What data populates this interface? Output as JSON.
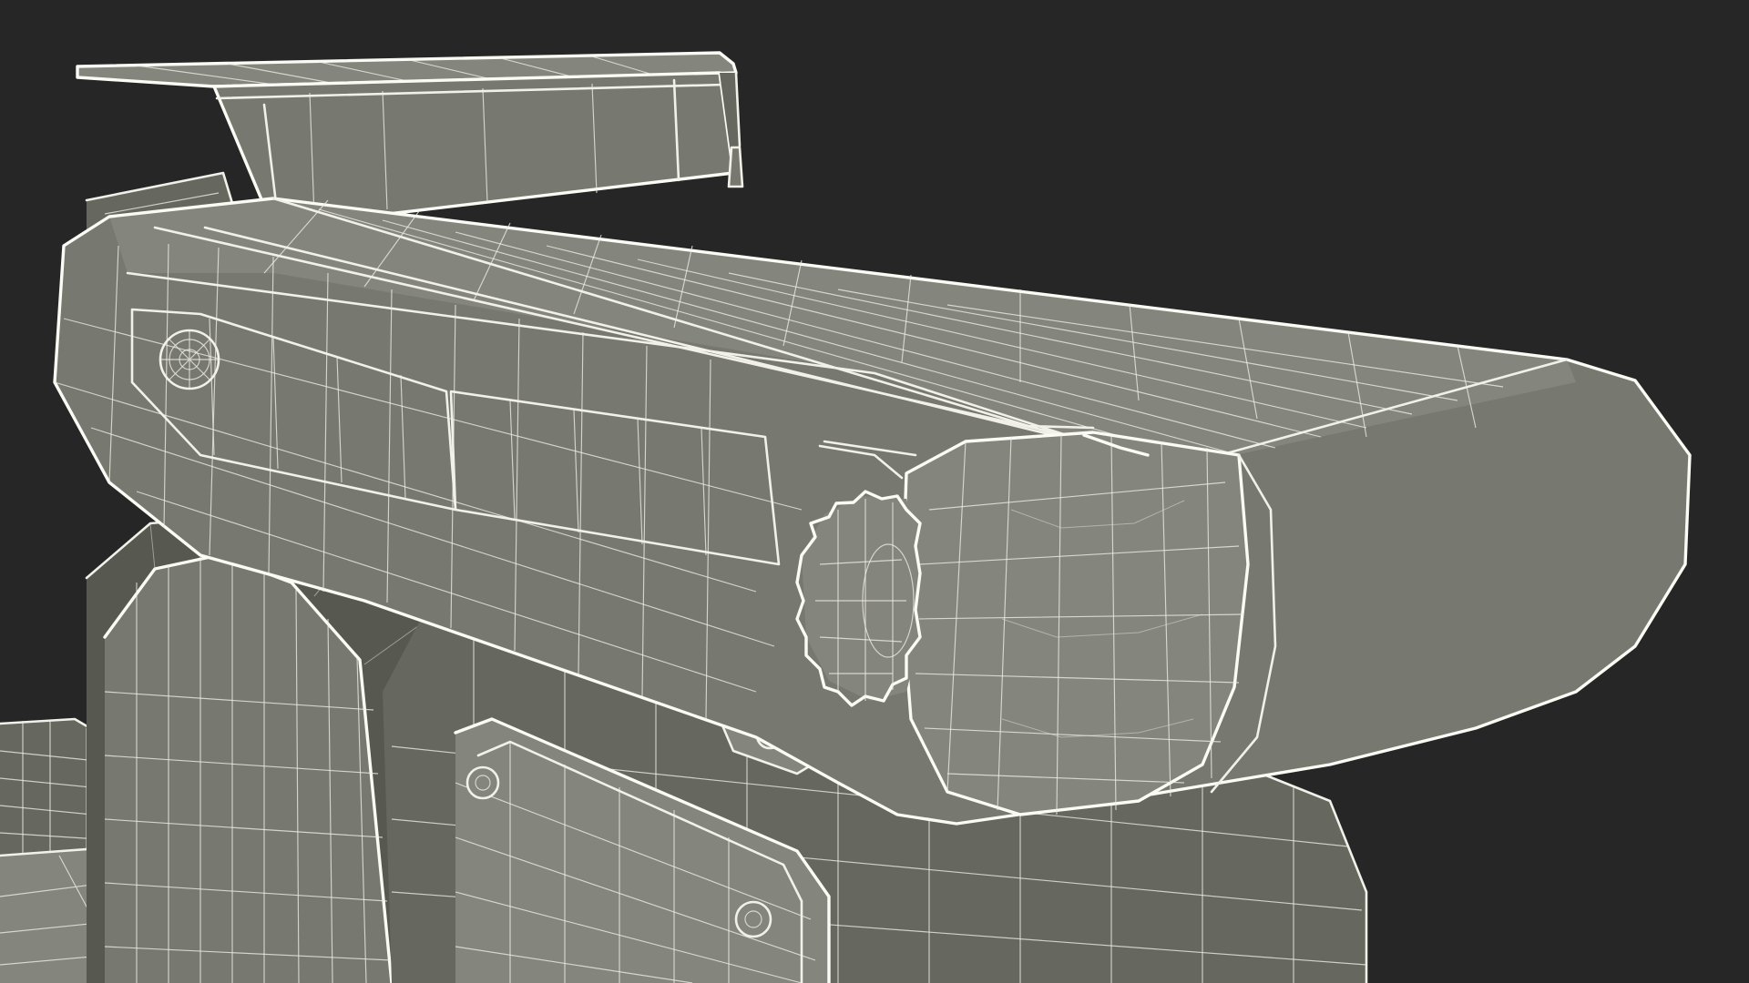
{
  "scene": {
    "subject": "wireframe-belt-sander-model",
    "background_color": "#262626",
    "surface_color": "#777870",
    "wire_color": "#eeeee5"
  }
}
